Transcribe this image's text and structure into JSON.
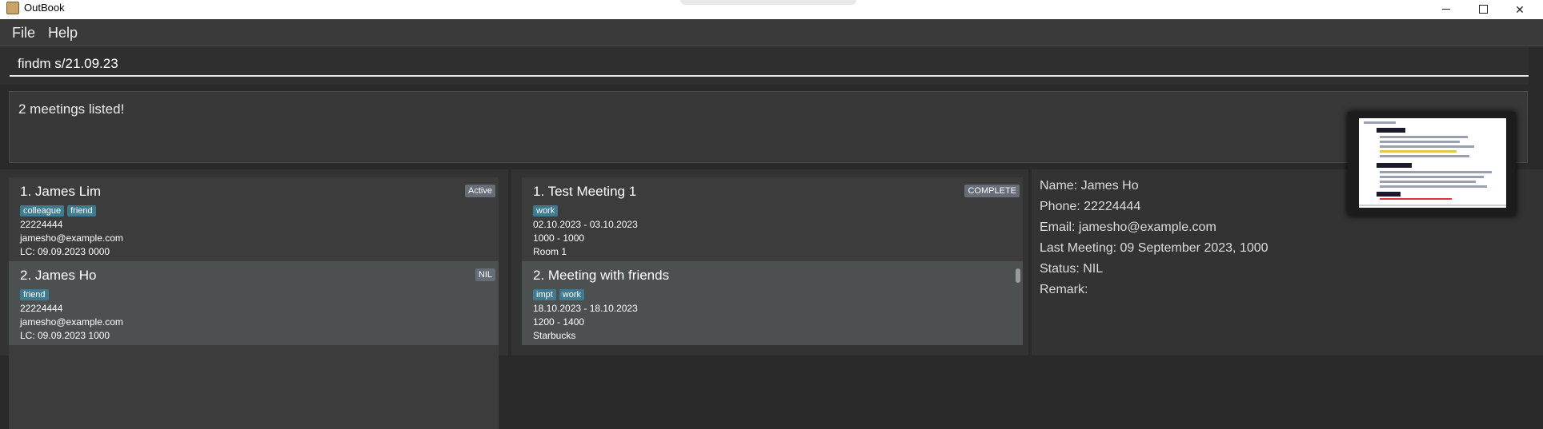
{
  "window": {
    "title": "OutBook"
  },
  "menu": {
    "file": "File",
    "help": "Help"
  },
  "command": {
    "value": "findm s/21.09.23"
  },
  "result": {
    "message": "2 meetings listed!"
  },
  "persons": [
    {
      "title": "1.  James Lim",
      "status": "Active",
      "tags": [
        "colleague",
        "friend"
      ],
      "phone": "22224444",
      "email": "jamesho@example.com",
      "last_contacted": "LC: 09.09.2023 0000"
    },
    {
      "title": "2.  James Ho",
      "status": "NIL",
      "tags": [
        "friend"
      ],
      "phone": "22224444",
      "email": "jamesho@example.com",
      "last_contacted": "LC: 09.09.2023 1000"
    }
  ],
  "meetings": [
    {
      "title": "1.  Test Meeting 1",
      "status": "COMPLETE",
      "tags": [
        "work"
      ],
      "dates": "02.10.2023  -  03.10.2023",
      "times": "1000  -  1000",
      "location": "Room 1"
    },
    {
      "title": "2.  Meeting with friends",
      "status": "",
      "tags": [
        "impt",
        "work"
      ],
      "dates": "18.10.2023  -  18.10.2023",
      "times": "1200  -  1400",
      "location": "Starbucks"
    }
  ],
  "details": {
    "name": "Name: James Ho",
    "phone": "Phone: 22224444",
    "email": "Email: jamesho@example.com",
    "last_meeting": "Last Meeting: 09 September 2023, 1000",
    "status": "Status: NIL",
    "remark": "Remark:"
  },
  "colors": {
    "background": "#2a2a2a",
    "tag": "#3e7b91",
    "status_badge": "#666d78",
    "selected_card": "#4c5050"
  }
}
